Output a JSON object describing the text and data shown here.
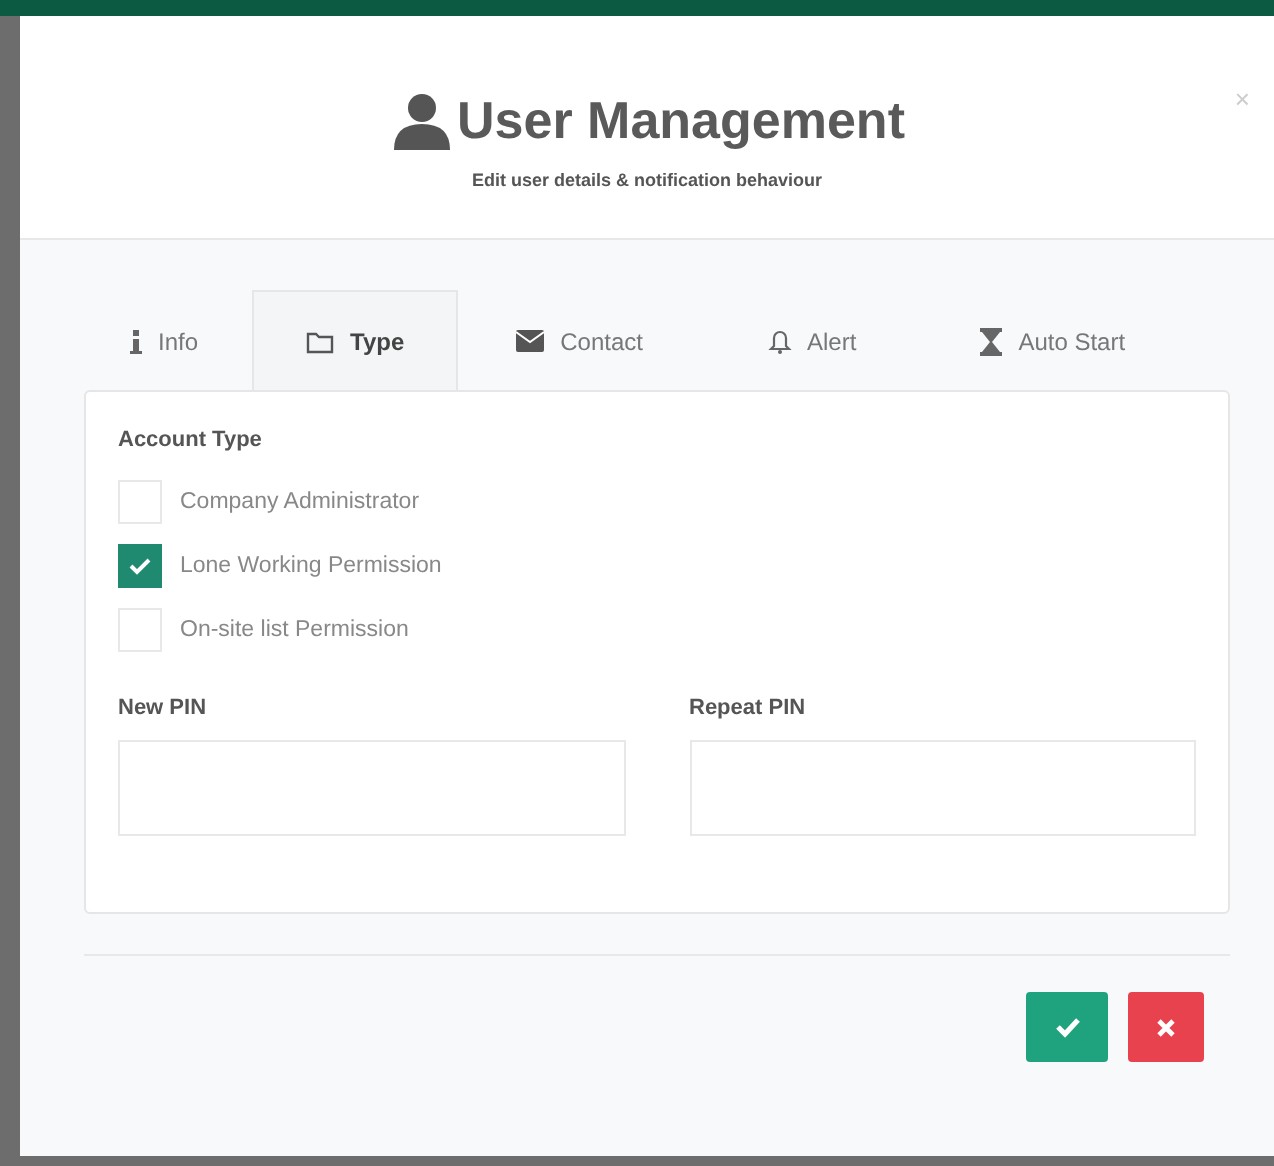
{
  "dialog": {
    "title": "User Management",
    "subtitle": "Edit user details & notification behaviour",
    "close": "×"
  },
  "tabs": [
    {
      "label": "Info",
      "kind": "info",
      "selected": false
    },
    {
      "label": "Type",
      "kind": "folder",
      "selected": true
    },
    {
      "label": "Contact",
      "kind": "envelope",
      "selected": false
    },
    {
      "label": "Alert",
      "kind": "bell",
      "selected": false
    },
    {
      "label": "Auto Start",
      "kind": "hourglass",
      "selected": false
    }
  ],
  "account_type": {
    "heading": "Account Type",
    "options": [
      {
        "label": "Company Administrator",
        "checked": false
      },
      {
        "label": "Lone Working Permission",
        "checked": true
      },
      {
        "label": "On-site list Permission",
        "checked": false
      }
    ]
  },
  "pin_fields": [
    {
      "label": "New PIN"
    },
    {
      "label": "Repeat PIN"
    }
  ],
  "buttons": [
    {
      "kind": "confirm"
    },
    {
      "kind": "cancel"
    }
  ]
}
